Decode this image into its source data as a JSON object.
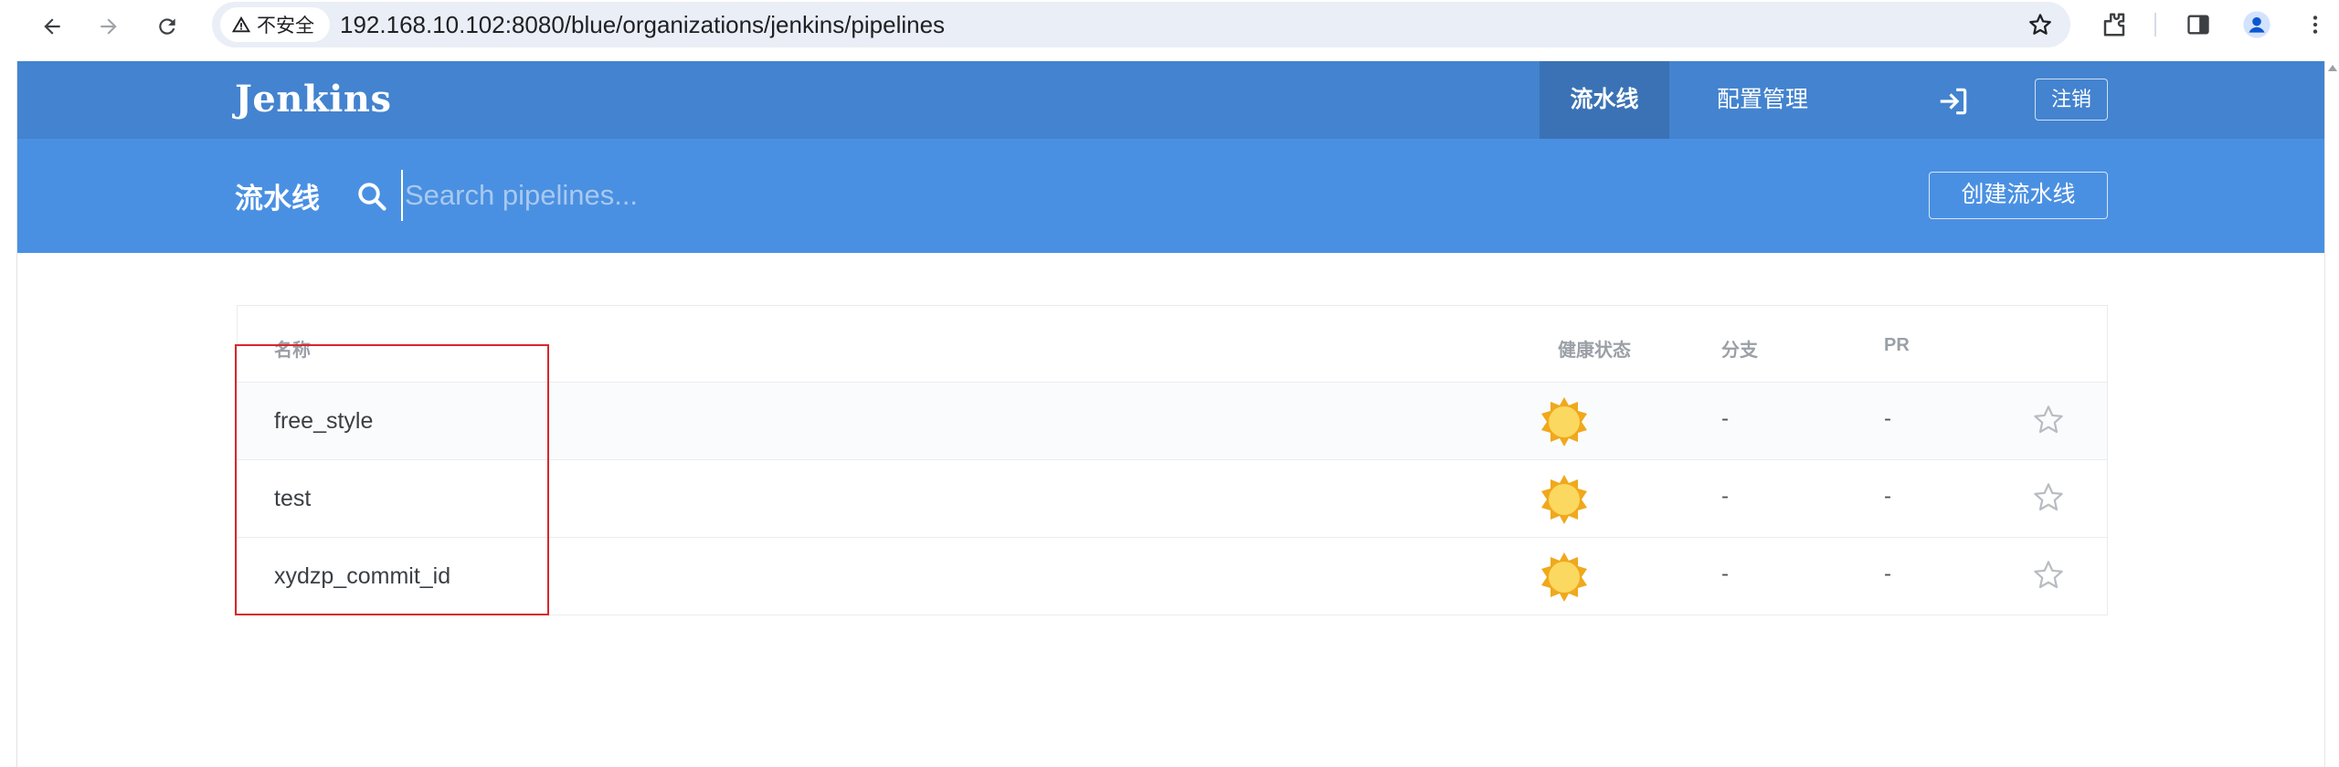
{
  "browser": {
    "security_label": "不安全",
    "url": "192.168.10.102:8080/blue/organizations/jenkins/pipelines"
  },
  "header": {
    "logo": "Jenkins",
    "tabs": [
      {
        "label": "流水线",
        "active": true
      },
      {
        "label": "配置管理",
        "active": false
      }
    ],
    "logout_label": "注销"
  },
  "subbar": {
    "title": "流水线",
    "search_placeholder": "Search pipelines...",
    "create_label": "创建流水线"
  },
  "table": {
    "columns": {
      "name": "名称",
      "health": "健康状态",
      "branches": "分支",
      "pr": "PR"
    },
    "rows": [
      {
        "name": "free_style",
        "health_icon": "sunny-weather-icon",
        "branches": "-",
        "pr": "-"
      },
      {
        "name": "test",
        "health_icon": "sunny-weather-icon",
        "branches": "-",
        "pr": "-"
      },
      {
        "name": "xydzp_commit_id",
        "health_icon": "sunny-weather-icon",
        "branches": "-",
        "pr": "-"
      }
    ]
  },
  "colors": {
    "top_bar": "#4383cf",
    "sub_bar": "#4a90e2",
    "highlight_box": "#d9262c",
    "sun_fill": "#f9d65b"
  }
}
